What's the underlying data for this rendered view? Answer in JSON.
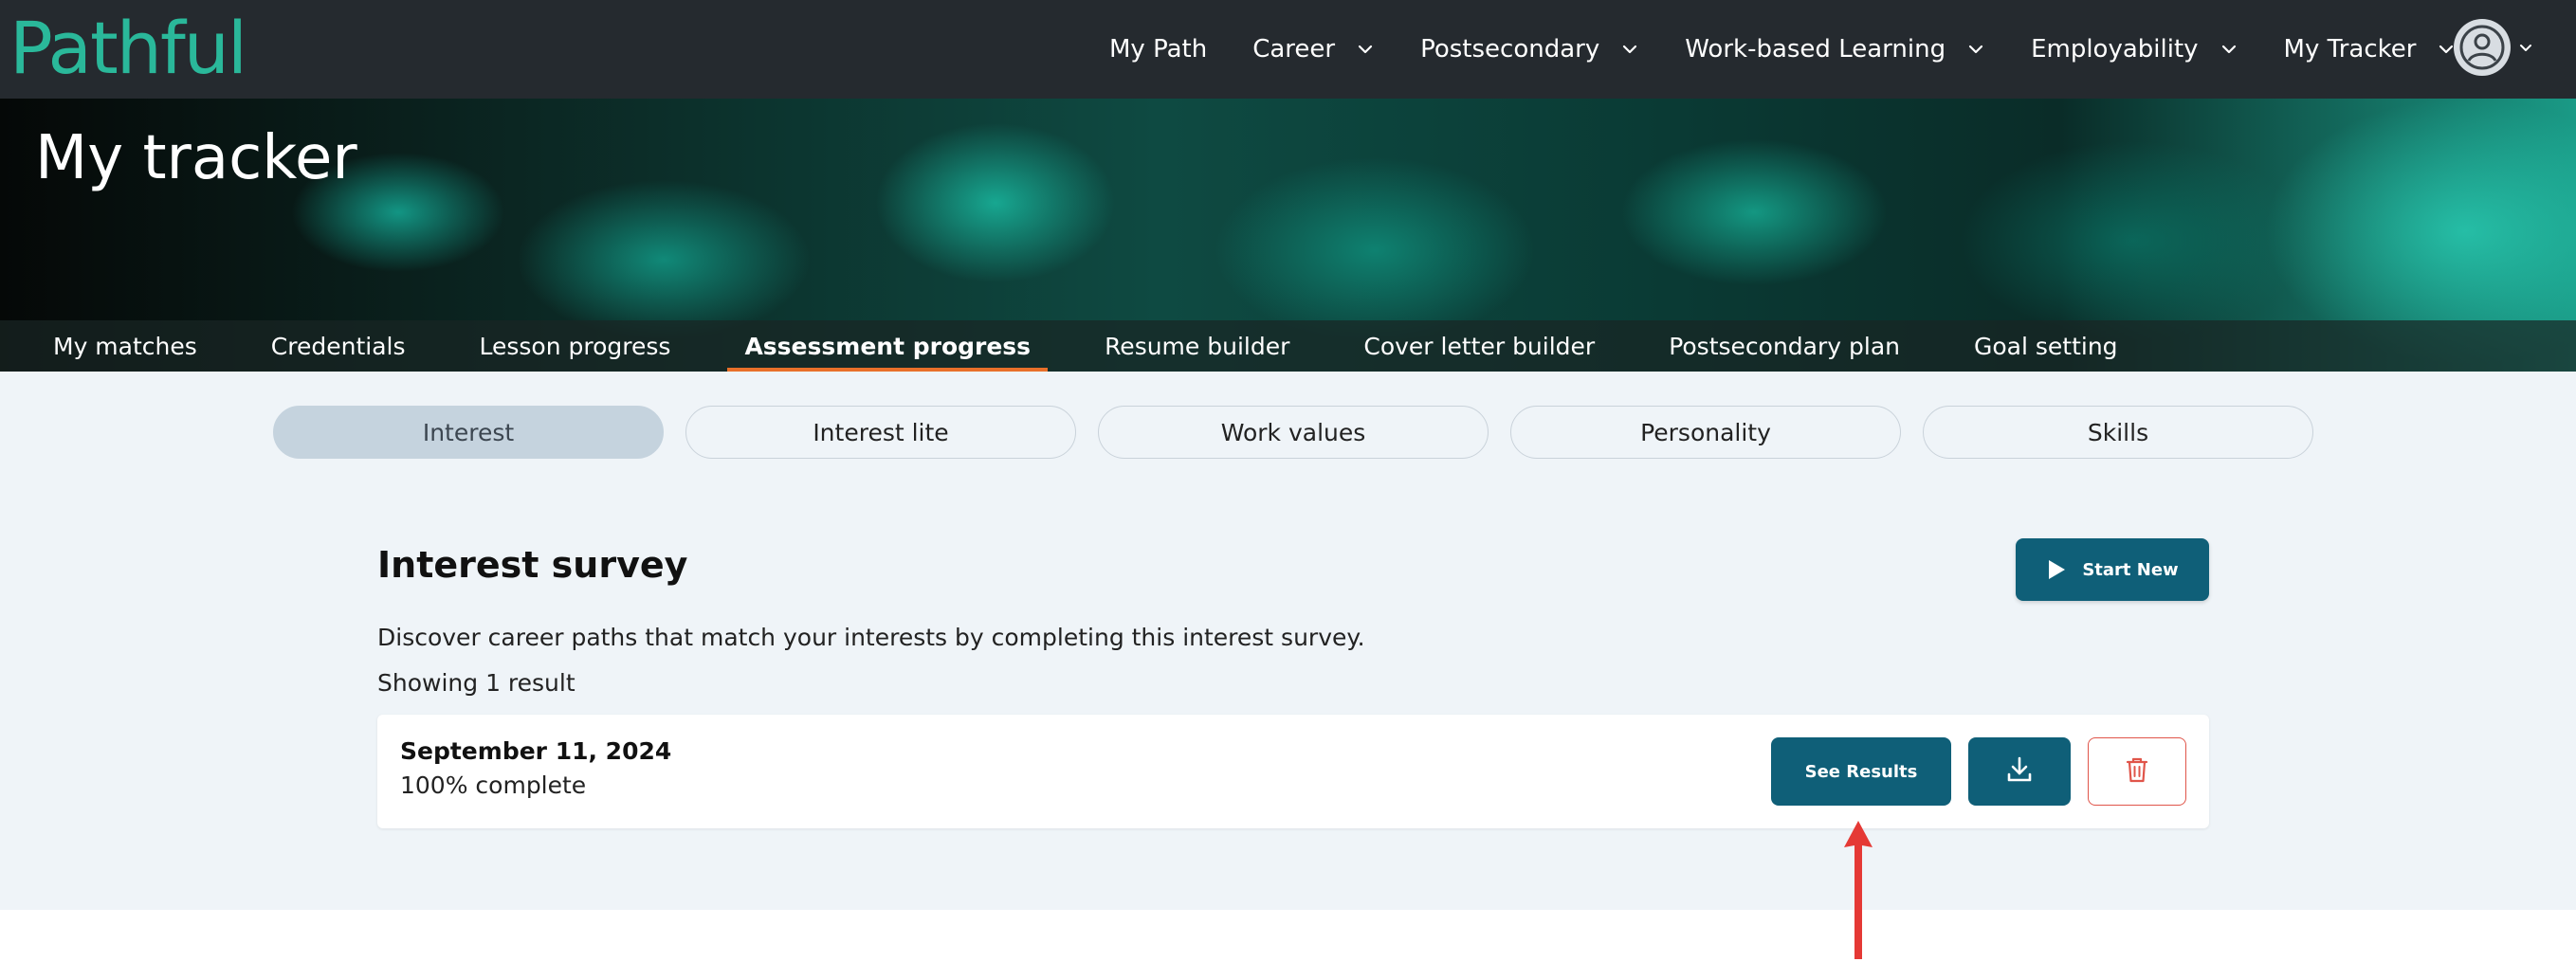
{
  "brand": {
    "logo_text": "Pathful",
    "accent": "#2ab89a"
  },
  "nav": {
    "items": [
      {
        "label": "My Path",
        "has_dropdown": false
      },
      {
        "label": "Career",
        "has_dropdown": true
      },
      {
        "label": "Postsecondary",
        "has_dropdown": true
      },
      {
        "label": "Work-based Learning",
        "has_dropdown": true
      },
      {
        "label": "Employability",
        "has_dropdown": true
      },
      {
        "label": "My Tracker",
        "has_dropdown": true
      }
    ],
    "avatar_icon": "user-circle-icon"
  },
  "hero": {
    "title": "My tracker",
    "subnav": [
      {
        "label": "My matches",
        "active": false
      },
      {
        "label": "Credentials",
        "active": false
      },
      {
        "label": "Lesson progress",
        "active": false
      },
      {
        "label": "Assessment progress",
        "active": true
      },
      {
        "label": "Resume builder",
        "active": false
      },
      {
        "label": "Cover letter builder",
        "active": false
      },
      {
        "label": "Postsecondary plan",
        "active": false
      },
      {
        "label": "Goal setting",
        "active": false
      }
    ]
  },
  "assessment_tabs": [
    {
      "label": "Interest",
      "active": true
    },
    {
      "label": "Interest lite",
      "active": false
    },
    {
      "label": "Work values",
      "active": false
    },
    {
      "label": "Personality",
      "active": false
    },
    {
      "label": "Skills",
      "active": false
    }
  ],
  "survey": {
    "title": "Interest survey",
    "start_label": "Start New",
    "description": "Discover career paths that match your interests by completing this interest survey.",
    "count_text": "Showing 1 result",
    "results": [
      {
        "date": "September 11, 2024",
        "status": "100% complete",
        "see_results_label": "See Results",
        "download_icon": "download-icon",
        "delete_icon": "trash-icon"
      }
    ]
  },
  "colors": {
    "primary_button": "#0f5f78",
    "active_underline": "#e8702a",
    "delete_border": "#e0554a",
    "annotation_arrow": "#e53935"
  }
}
